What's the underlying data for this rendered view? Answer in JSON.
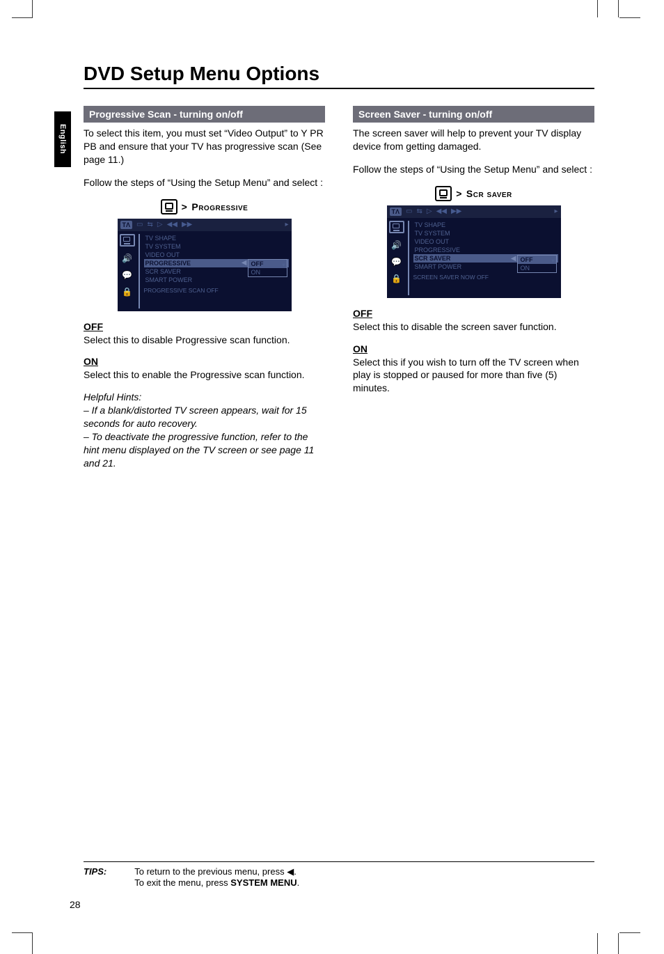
{
  "sidebar_tab": "English",
  "page_title": "DVD Setup Menu Options",
  "page_number": "28",
  "left": {
    "bar": "Progressive Scan - turning on/off",
    "intro1": "To select this item, you must set “Video Output” to Y PR PB and ensure that your TV has progressive scan (See page 11.)",
    "intro2": "Follow the steps of “Using the Setup Menu” and select :",
    "breadcrumb": "Progressive",
    "osd": {
      "topbar_tab": "TΛ",
      "items": [
        "TV SHAPE",
        "TV SYSTEM",
        "VIDEO OUT",
        "PROGRESSIVE",
        "SCR SAVER",
        "SMART POWER"
      ],
      "selected_index": 3,
      "sub": [
        "OFF",
        "ON"
      ],
      "sub_selected": 0,
      "status": "PROGRESSIVE SCAN OFF"
    },
    "off_head": "OFF",
    "off_body": "Select this to disable Progressive scan function.",
    "on_head": "ON",
    "on_body": "Select this to enable the Progressive scan function.",
    "hints_head": "Helpful Hints:",
    "hint1": "–  If a blank/distorted TV screen appears, wait for 15 seconds for auto recovery.",
    "hint2": "–  To deactivate the progressive function, refer to the hint menu displayed on the TV screen or see page 11 and 21."
  },
  "right": {
    "bar": "Screen Saver - turning on/off",
    "intro1": "The screen saver will help to prevent your TV display device from getting damaged.",
    "intro2": "Follow the steps of “Using the Setup Menu” and select :",
    "breadcrumb": "Scr saver",
    "osd": {
      "topbar_tab": "TΛ",
      "items": [
        "TV SHAPE",
        "TV SYSTEM",
        "VIDEO OUT",
        "PROGRESSIVE",
        "SCR SAVER",
        "SMART POWER"
      ],
      "selected_index": 4,
      "sub": [
        "OFF",
        "ON"
      ],
      "sub_selected": 0,
      "status": "SCREEN SAVER NOW OFF"
    },
    "off_head": "OFF",
    "off_body": "Select this to disable the screen saver function.",
    "on_head": "ON",
    "on_body": "Select this if you wish to turn off the TV screen when play is stopped or paused for more than five (5) minutes."
  },
  "tips": {
    "label": "TIPS:",
    "line1a": "To return to the previous menu, press ",
    "line1b": ".",
    "left_glyph": "◀",
    "line2a": "To  exit the menu, press ",
    "line2bold": "SYSTEM MENU",
    "line2b": "."
  }
}
